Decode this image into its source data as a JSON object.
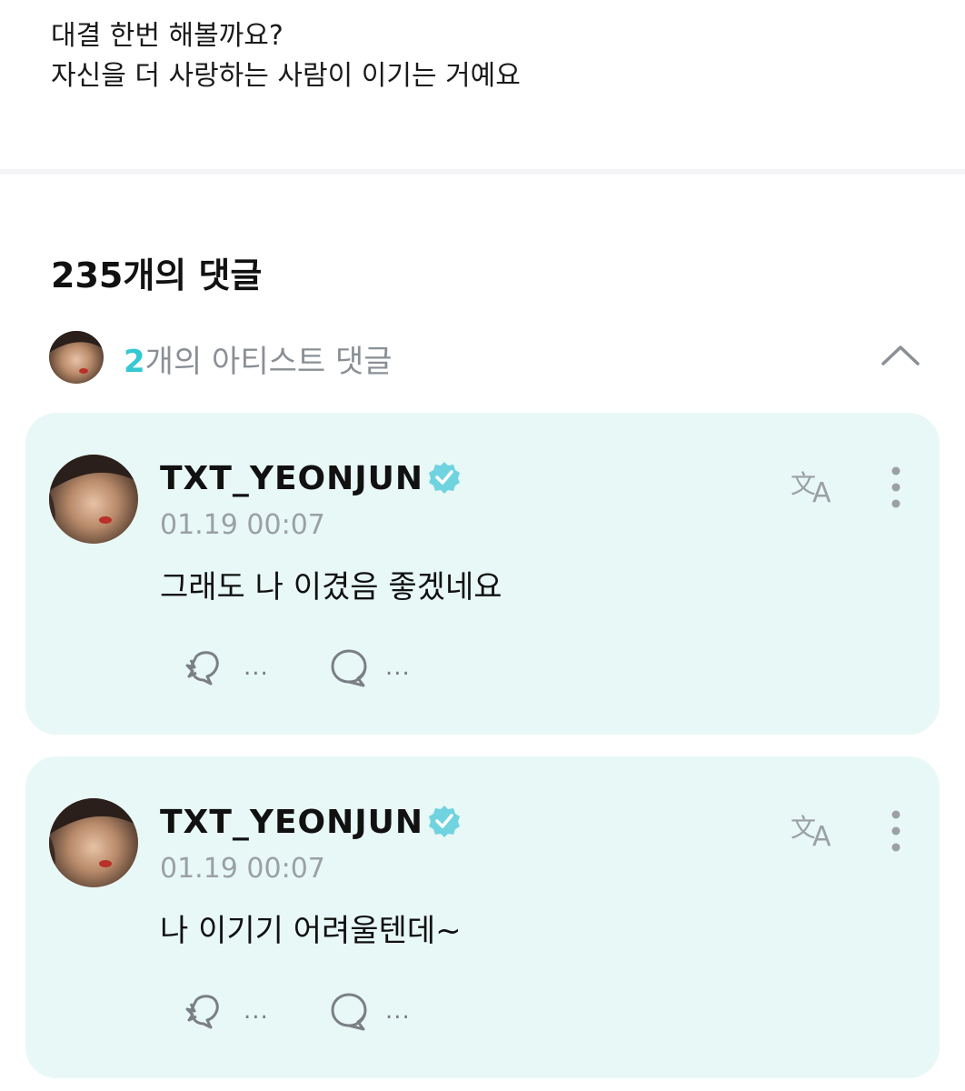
{
  "post": {
    "line1": "대결 한번 해볼까요?",
    "line2": "자신을 더 사랑하는 사람이 이기는 거예요"
  },
  "comments_header": {
    "title": "235개의 댓글"
  },
  "artist_comments": {
    "count": "2",
    "label": "개의 아티스트 댓글",
    "icon": "chevron-up-icon"
  },
  "colors": {
    "accent": "#34c8d3",
    "card_bg": "#e8f8f6",
    "muted": "#9aa0a6"
  },
  "comments": [
    {
      "author": "TXT_YEONJUN",
      "time": "01.19 00:07",
      "text": "그래도 나 이겼음 좋겠네요",
      "like_count": "...",
      "reply_count": "..."
    },
    {
      "author": "TXT_YEONJUN",
      "time": "01.19 00:07",
      "text": "나 이기기 어려울텐데~",
      "like_count": "...",
      "reply_count": "..."
    }
  ]
}
